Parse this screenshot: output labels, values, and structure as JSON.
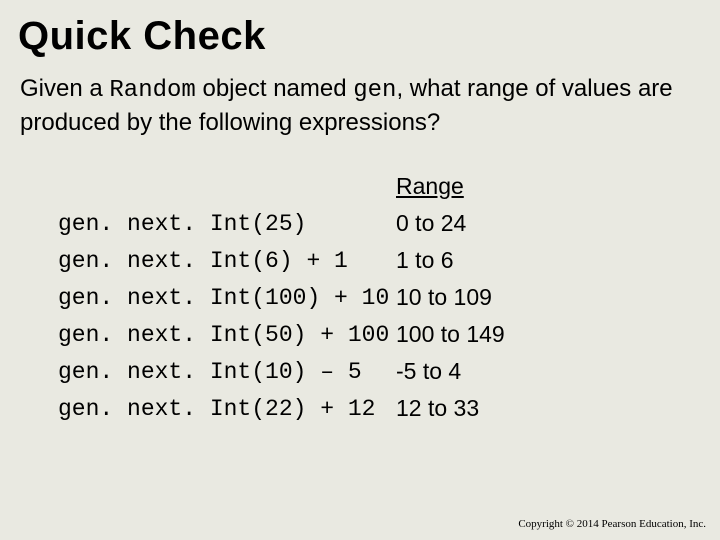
{
  "title": "Quick Check",
  "intro": {
    "prefix": "Given a ",
    "code1": "Random",
    "mid": " object named ",
    "code2": "gen",
    "suffix": ", what range of values are produced by the following expressions?"
  },
  "header": {
    "range": "Range"
  },
  "rows": [
    {
      "expr": "gen. next. Int(25)",
      "range": "0 to 24"
    },
    {
      "expr": "gen. next. Int(6) + 1",
      "range": "1 to 6"
    },
    {
      "expr": "gen. next. Int(100) + 10",
      "range": "10 to 109"
    },
    {
      "expr": "gen. next. Int(50) + 100",
      "range": "100 to 149"
    },
    {
      "expr": "gen. next. Int(10) – 5",
      "range": "-5 to 4"
    },
    {
      "expr": "gen. next. Int(22) + 12",
      "range": "12 to 33"
    }
  ],
  "copyright": "Copyright © 2014 Pearson Education, Inc."
}
